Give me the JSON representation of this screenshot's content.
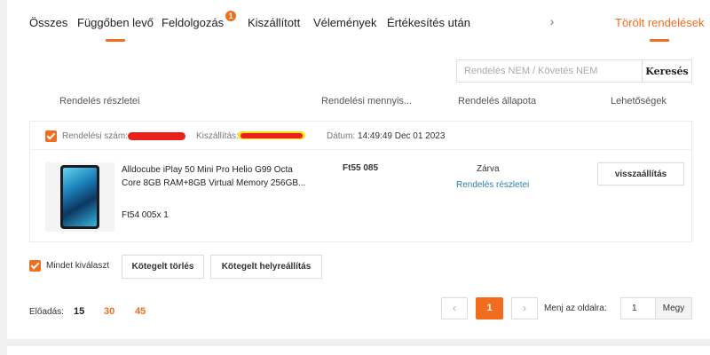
{
  "tabs": [
    {
      "label": "Összes"
    },
    {
      "label": "Függőben levő"
    },
    {
      "label": "Feldolgozás",
      "badge": "1"
    },
    {
      "label": "Kiszállított"
    },
    {
      "label": "Vélemények"
    },
    {
      "label": "Értékesítés után"
    }
  ],
  "tab_arrow": "›",
  "deleted_tab": "Törölt rendelések",
  "search": {
    "placeholder": "Rendelés NEM / Követés NEM",
    "button": "Keresés"
  },
  "columns": [
    "Rendelés részletei",
    "Rendelési mennyis...",
    "Rendelés állapota",
    "Lehetőségek"
  ],
  "order": {
    "number_label": "Rendelési szám:",
    "shipping_label": "Kiszállítás:",
    "date_label": "Dátum:",
    "date_value": "14:49:49 Dec 01 2023",
    "product_title": "Alldocube iPlay 50 Mini Pro Helio G99 Octa Core 8GB RAM+8GB Virtual Memory 256GB...",
    "product_price": "Ft54 005x 1",
    "quantity": "Ft55 085",
    "status": "Zárva",
    "details_link": "Rendelés részletei",
    "restore_button": "visszaállítás"
  },
  "bulk": {
    "select_all": "Mindet kiválaszt",
    "delete_button": "Kötegelt törlés",
    "restore_button": "Kötegelt helyreállítás"
  },
  "pagination": {
    "per_page_label": "Előadás:",
    "per_page_options": [
      "15",
      "30",
      "45"
    ],
    "prev": "‹",
    "current_page": "1",
    "next": "›",
    "goto_label": "Menj az oldalra:",
    "goto_value": "1",
    "goto_button": "Megy"
  },
  "colors": {
    "accent": "#f26c1e",
    "link": "#2d7ea8",
    "redaction_red": "#e8211c",
    "redaction_yellow": "#f5e60f"
  }
}
